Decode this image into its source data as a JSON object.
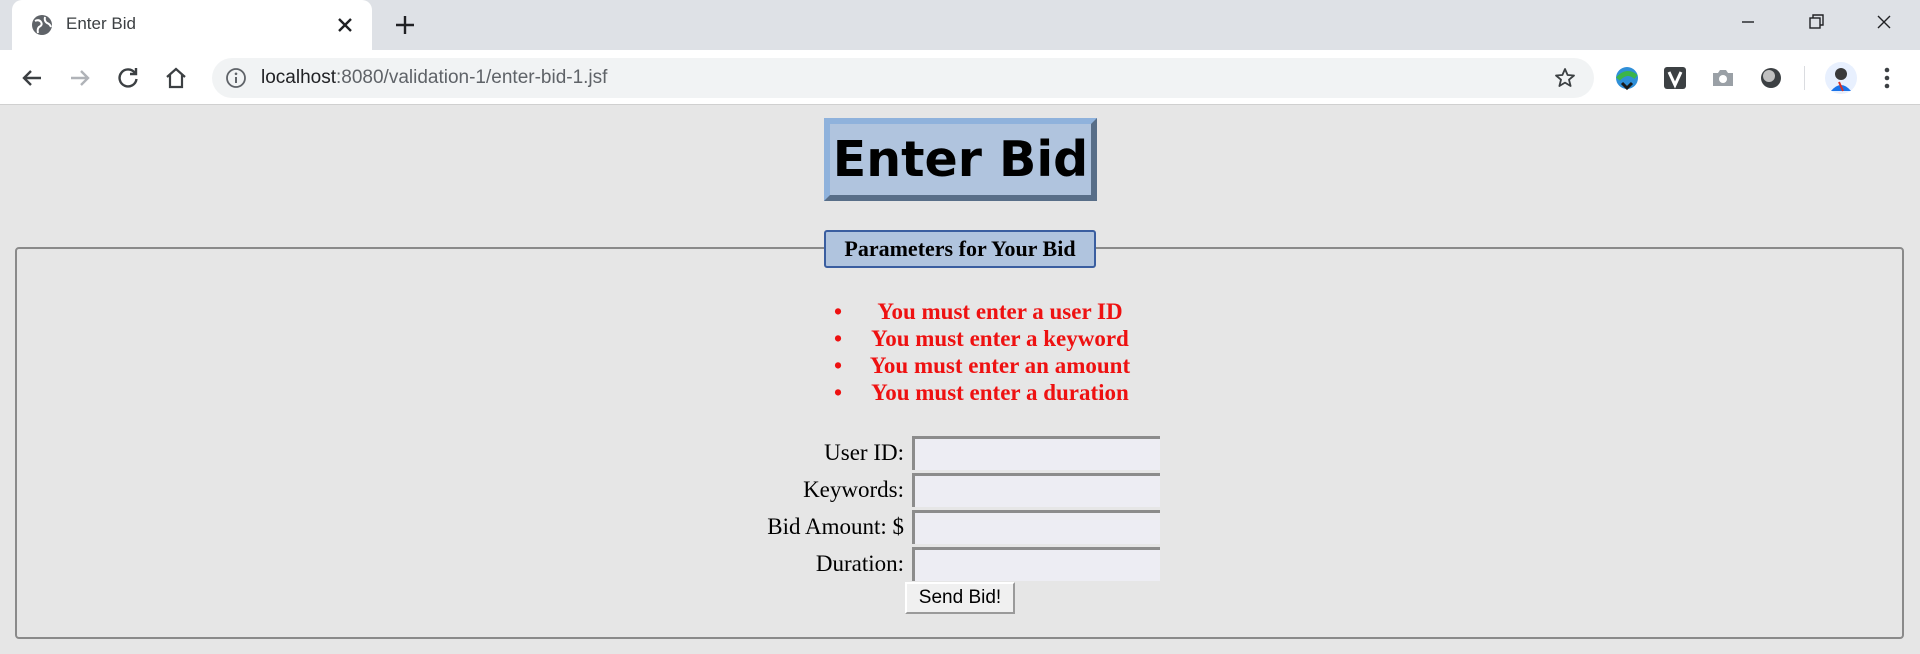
{
  "browser": {
    "tab_title": "Enter Bid",
    "url_host": "localhost",
    "url_rest": ":8080/validation-1/enter-bid-1.jsf",
    "icons": [
      "globe-icon",
      "close-icon",
      "plus-icon",
      "minimize-icon",
      "restore-icon",
      "window-close-icon",
      "back-arrow-icon",
      "forward-arrow-icon",
      "reload-icon",
      "home-icon",
      "info-icon",
      "star-icon",
      "extension-downloader-icon",
      "extension-v-icon",
      "camera-icon",
      "extension-circle-icon",
      "profile-avatar-icon",
      "kebab-menu-icon"
    ]
  },
  "page": {
    "title": "Enter Bid",
    "legend": "Parameters for Your Bid",
    "errors": [
      "You must enter a user ID",
      "You must enter a keyword",
      "You must enter an amount",
      "You must enter a duration"
    ],
    "bullet": "•",
    "fields": {
      "user_id_label": "User ID:",
      "keywords_label": "Keywords:",
      "bid_amount_label": "Bid Amount: $",
      "duration_label": "Duration:",
      "user_id_value": "",
      "keywords_value": "",
      "bid_amount_value": "",
      "duration_value": ""
    },
    "submit_label": "Send Bid!"
  },
  "colors": {
    "page_bg": "#e6e6e6",
    "title_bg": "#b0c4de",
    "error_red": "#ee1111"
  }
}
